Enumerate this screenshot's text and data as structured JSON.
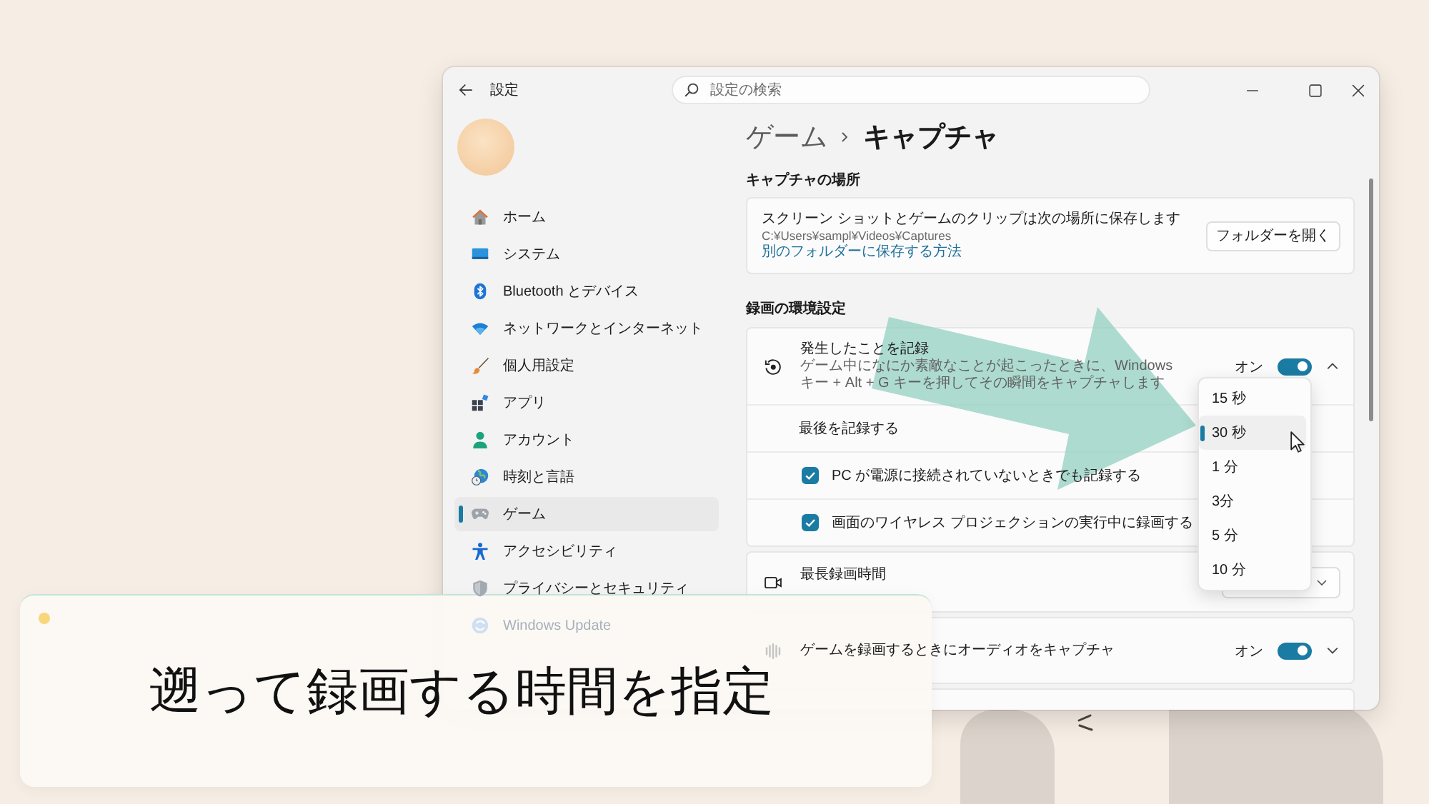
{
  "window": {
    "title": "設定",
    "search": {
      "placeholder": "設定の検索"
    }
  },
  "sidebar": {
    "items": [
      {
        "label": "ホーム",
        "selected": false
      },
      {
        "label": "システム",
        "selected": false
      },
      {
        "label": "Bluetooth とデバイス",
        "selected": false
      },
      {
        "label": "ネットワークとインターネット",
        "selected": false
      },
      {
        "label": "個人用設定",
        "selected": false
      },
      {
        "label": "アプリ",
        "selected": false
      },
      {
        "label": "アカウント",
        "selected": false
      },
      {
        "label": "時刻と言語",
        "selected": false
      },
      {
        "label": "ゲーム",
        "selected": true
      },
      {
        "label": "アクセシビリティ",
        "selected": false
      },
      {
        "label": "プライバシーとセキュリティ",
        "selected": false
      },
      {
        "label": "Windows Update",
        "selected": false
      }
    ]
  },
  "breadcrumb": [
    "ゲーム",
    "キャプチャ"
  ],
  "sections": [
    {
      "title": "キャプチャの場所",
      "cards": [
        {
          "kind": "location",
          "title": "スクリーン ショットとゲームのクリップは次の場所に保存します",
          "path": "C:¥Users¥sampl¥Videos¥Captures",
          "link": "別のフォルダーに保存する方法",
          "button": "フォルダーを開く"
        }
      ]
    },
    {
      "title": "録画の環境設定",
      "cards": [
        {
          "kind": "toggle",
          "title": "発生したことを記録",
          "description": "ゲーム中になにか素敵なことが起こったときに、Windows キー + Alt + G キーを押してその瞬間をキャプチャします",
          "toggle_label": "オン",
          "on": true,
          "expanded": true,
          "rows": [
            {
              "kind": "dropdown",
              "label": "最後を記録する",
              "options": [
                {
                  "label": "15 秒",
                  "selected": false
                },
                {
                  "label": "30 秒",
                  "selected": true
                },
                {
                  "label": "1 分",
                  "selected": false
                },
                {
                  "label": "3分",
                  "selected": false
                },
                {
                  "label": "5 分",
                  "selected": false
                },
                {
                  "label": "10 分",
                  "selected": false
                }
              ]
            },
            {
              "kind": "checkbox",
              "label": "PC が電源に接続されていないときでも記録する",
              "checked": true
            },
            {
              "kind": "checkbox",
              "label": "画面のワイヤレス プロジェクションの実行中に録画する",
              "checked": true
            }
          ]
        },
        {
          "kind": "dropdown",
          "title": "最長録画時間"
        },
        {
          "kind": "toggle",
          "title": "ゲームを録画するときにオーディオをキャプチャ",
          "toggle_label": "オン",
          "on": true,
          "expanded": false
        }
      ]
    }
  ],
  "caption": {
    "text": "遡って録画する時間を指定"
  }
}
